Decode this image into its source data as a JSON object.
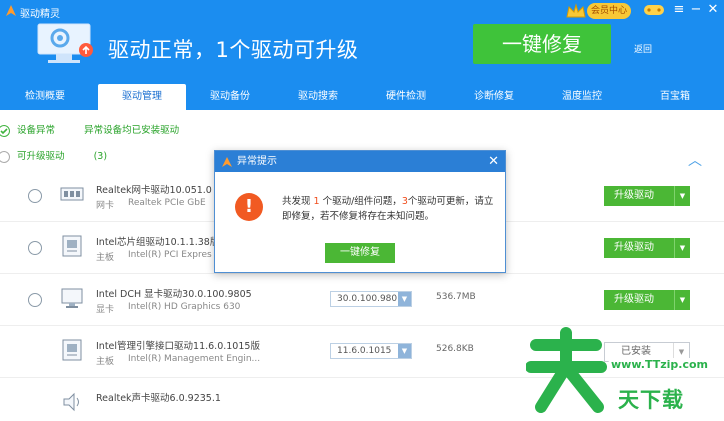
{
  "app": {
    "title": "驱动精灵",
    "vip_label": "会员中心"
  },
  "window_controls": {
    "menu": "≡",
    "minimize": "−",
    "close": "✕"
  },
  "header": {
    "status_text": "驱动正常，1个驱动可升级",
    "fix_all_label": "一键修复",
    "back_label": "返回"
  },
  "tabs": [
    {
      "label": "检测概要"
    },
    {
      "label": "驱动管理"
    },
    {
      "label": "驱动备份"
    },
    {
      "label": "驱动搜索"
    },
    {
      "label": "硬件检测"
    },
    {
      "label": "诊断修复"
    },
    {
      "label": "温度监控"
    },
    {
      "label": "百宝箱"
    }
  ],
  "sections": {
    "device_abnormal": {
      "label": "设备异常",
      "note": "异常设备均已安装驱动"
    },
    "upgradable": {
      "label": "可升级驱动",
      "count": "(3)"
    }
  },
  "drivers": [
    {
      "name": "Realtek网卡驱动10.051.0",
      "type": "网卡",
      "device": "Realtek PCIe GbE",
      "version": "",
      "size": "",
      "action": "升级驱动",
      "icon": "network-card-icon"
    },
    {
      "name": "Intel芯片组驱动10.1.1.38版",
      "type": "主板",
      "device": "Intel(R) PCI Expres",
      "version": "",
      "size": "",
      "action": "升级驱动",
      "icon": "motherboard-icon"
    },
    {
      "name": "Intel DCH 显卡驱动30.0.100.9805",
      "type": "显卡",
      "device": "Intel(R) HD Graphics 630",
      "version": "30.0.100.980",
      "size": "536.7MB",
      "action": "升级驱动",
      "icon": "monitor-icon"
    },
    {
      "name": "Intel管理引擎接口驱动11.6.0.1015版",
      "type": "主板",
      "device": "Intel(R) Management Engin...",
      "version": "11.6.0.1015",
      "size": "526.8KB",
      "action": "已安装",
      "icon": "motherboard-icon"
    },
    {
      "name": "Realtek声卡驱动6.0.9235.1",
      "type": "",
      "device": "",
      "version": "",
      "size": "",
      "action": "",
      "icon": "speaker-icon"
    }
  ],
  "dialog": {
    "title": "异常提示",
    "close": "✕",
    "message_parts": [
      "共发现 ",
      "1",
      " 个驱动/组件问题，",
      "3",
      "个驱动可更新，请立即修复，若不修复将存在未知问题。"
    ],
    "button_label": "一键修复"
  },
  "watermark": {
    "url": "www.TTzip.com",
    "text": "天下载"
  },
  "colors": {
    "brand_blue": "#1b8df0",
    "green": "#4bb735",
    "warning": "#f15a22"
  }
}
